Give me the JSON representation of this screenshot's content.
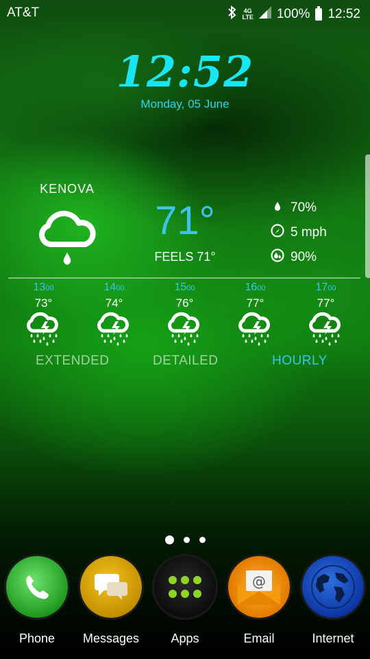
{
  "status_bar": {
    "carrier": "AT&T",
    "network": "4G",
    "network_sub": "LTE",
    "battery": "100%",
    "time": "12:52"
  },
  "clock": {
    "time": "12:52",
    "date": "Monday, 05 June"
  },
  "weather": {
    "location": "KENOVA",
    "temperature": "71°",
    "feels_like": "FEELS 71°",
    "humidity": "70%",
    "wind": "5 mph",
    "precipitation": "90%",
    "condition_icon": "rain-cloud-icon",
    "hourly": [
      {
        "hour": "13",
        "suffix": "00",
        "temp": "73°",
        "icon": "thunder-rain-icon"
      },
      {
        "hour": "14",
        "suffix": "00",
        "temp": "74°",
        "icon": "thunder-rain-icon"
      },
      {
        "hour": "15",
        "suffix": "00",
        "temp": "76°",
        "icon": "thunder-rain-icon"
      },
      {
        "hour": "16",
        "suffix": "00",
        "temp": "77°",
        "icon": "thunder-rain-icon"
      },
      {
        "hour": "17",
        "suffix": "00",
        "temp": "77°",
        "icon": "thunder-rain-icon"
      }
    ],
    "tabs": {
      "extended": "EXTENDED",
      "detailed": "DETAILED",
      "hourly": "HOURLY",
      "active": "hourly"
    },
    "accent_color": "#3ec3ea"
  },
  "pages": {
    "count": 3,
    "active": 0
  },
  "dock": [
    {
      "label": "Phone",
      "icon": "phone-icon"
    },
    {
      "label": "Messages",
      "icon": "messages-icon"
    },
    {
      "label": "Apps",
      "icon": "apps-grid-icon"
    },
    {
      "label": "Email",
      "icon": "email-icon"
    },
    {
      "label": "Internet",
      "icon": "globe-icon"
    }
  ]
}
